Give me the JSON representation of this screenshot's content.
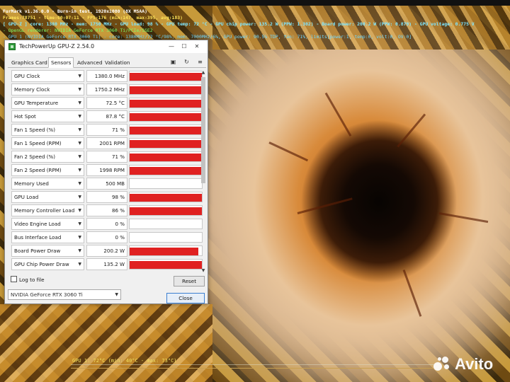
{
  "overlay": {
    "line1": "FurMark v1.36.0.0 - Burn-in test, 1920x1080 (8X MSAA)",
    "line2": "Frames:78751 - time:00:07:11 - FPS:176 (min:147, max:395, avg:183)",
    "line3": "[ GPU-Z ] core: 1380 MHz - mem: 1750 MHz - GPU load: 98 % - GPU temp: 72 °C - GPU chip power: 135.2 W (PPW: 1.302) - Board power: 200.2 W (PPW: 0.879) - GPU voltage: 0.775 V",
    "line4": "- OpenGL renderer: NVIDIA GeForce RTX 3060 Ti/PCIe/SSE2",
    "line5": "- GPU 1 (NVIDIA GeForce RTX 3060 Ti) - core: 1380MHz/72 °C/98%, mem: 7000MHz/6%, GPU power: 90.5% TDP, fan: 71%, limits[power:1, temp:0, volt:0, OV:0]"
  },
  "window": {
    "title": "TechPowerUp GPU-Z 2.54.0",
    "minimize": "—",
    "maximize": "☐",
    "close": "✕"
  },
  "tabs": [
    "Graphics Card",
    "Sensors",
    "Advanced",
    "Validation"
  ],
  "toolbar_icons": [
    "camera-icon",
    "refresh-icon",
    "menu-icon"
  ],
  "sensors": [
    {
      "name": "GPU Clock",
      "value": "1380.0 MHz",
      "fill": 1.0
    },
    {
      "name": "Memory Clock",
      "value": "1750.2 MHz",
      "fill": 1.0
    },
    {
      "name": "GPU Temperature",
      "value": "72.5 °C",
      "fill": 1.0
    },
    {
      "name": "Hot Spot",
      "value": "87.8 °C",
      "fill": 1.0
    },
    {
      "name": "Fan 1 Speed (%)",
      "value": "71 %",
      "fill": 1.0
    },
    {
      "name": "Fan 1 Speed (RPM)",
      "value": "2001 RPM",
      "fill": 1.0
    },
    {
      "name": "Fan 2 Speed (%)",
      "value": "71 %",
      "fill": 1.0
    },
    {
      "name": "Fan 2 Speed (RPM)",
      "value": "1998 RPM",
      "fill": 1.0
    },
    {
      "name": "Memory Used",
      "value": "500 MB",
      "fill": 0
    },
    {
      "name": "GPU Load",
      "value": "98 %",
      "fill": 1.0
    },
    {
      "name": "Memory Controller Load",
      "value": "86 %",
      "fill": 1.0
    },
    {
      "name": "Video Engine Load",
      "value": "0 %",
      "fill": 0
    },
    {
      "name": "Bus Interface Load",
      "value": "0 %",
      "fill": 0
    },
    {
      "name": "Board Power Draw",
      "value": "200.2 W",
      "fill": 0.95
    },
    {
      "name": "GPU Chip Power Draw",
      "value": "135.2 W",
      "fill": 1.0
    }
  ],
  "log_label": "Log to file",
  "reset_label": "Reset",
  "gpu_select": "NVIDIA GeForce RTX 3060 Ti",
  "close_label": "Close",
  "bottom_hud": "GPU 1: 72°C (min: 40°C - max: 73°C)",
  "watermark": "Avito",
  "colors": {
    "sensor_fill": "#e02121",
    "overlay_yellow": "#ffe45a",
    "overlay_cyan": "#7fe6ff"
  }
}
